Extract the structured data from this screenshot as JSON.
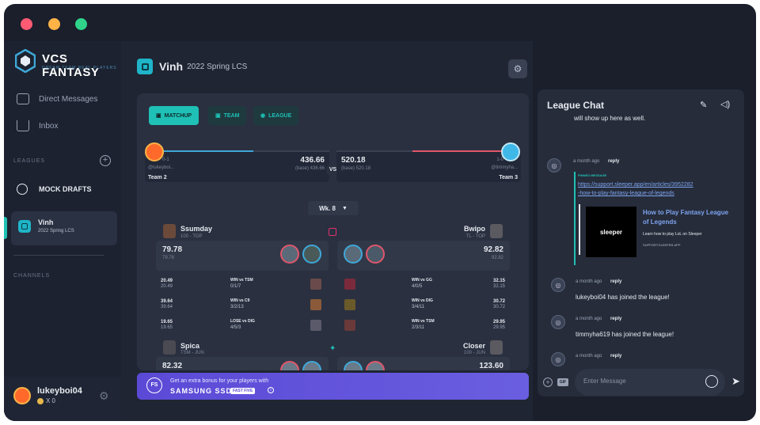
{
  "window": {
    "dots": [
      "#ff5a73",
      "#ffb347",
      "#2fd38a"
    ]
  },
  "brand": {
    "title": "VCS FANTASY",
    "subtitle": "DREAM TEAM REAL PLAYERS"
  },
  "sidebar": {
    "nav": [
      {
        "label": "Direct Messages",
        "icon": "message-icon"
      },
      {
        "label": "Inbox",
        "icon": "inbox-icon"
      }
    ],
    "leagues_header": "LEAGUES",
    "mock_drafts": "MOCK DRAFTS",
    "league": {
      "name": "Vinh",
      "season": "2022 Spring LCS"
    },
    "channels_header": "CHANNELS",
    "user": {
      "name": "lukeyboi04",
      "coins": "X 0"
    }
  },
  "main": {
    "league_name": "Vinh",
    "season": "2022 Spring LCS",
    "tabs": [
      {
        "label": "MATCHUP"
      },
      {
        "label": "TEAM"
      },
      {
        "label": "LEAGUE"
      }
    ],
    "matchup": {
      "left": {
        "record": "0-1",
        "handle": "@lukeyboi...",
        "score": "436.66",
        "base": "(base) 436.66",
        "team": "Team 2"
      },
      "right": {
        "record": "1-0",
        "handle": "@timmyha...",
        "score": "520.18",
        "base": "(base) 520.18",
        "team": "Team 3"
      },
      "vs": "VS",
      "week": "Wk. 8"
    },
    "players": [
      {
        "left": {
          "name": "Ssumday",
          "meta": "100 - TOP",
          "score": "79.78",
          "sub": "79.78"
        },
        "right": {
          "name": "Bwipo",
          "meta": "TL - TOP",
          "score": "92.82",
          "sub": "92.82"
        },
        "games": [
          {
            "l_pts": "20.49",
            "l_sub": "20.49",
            "l_res": "WIN vs TSM",
            "l_kda": "0/1/7",
            "r_res": "WIN vs GG",
            "r_kda": "4/0/5",
            "r_pts": "32.15",
            "r_sub": "32.15"
          },
          {
            "l_pts": "39.64",
            "l_sub": "39.64",
            "l_res": "WIN vs C9",
            "l_kda": "3/2/13",
            "r_res": "WIN vs DIG",
            "r_kda": "3/4/11",
            "r_pts": "30.72",
            "r_sub": "30.72"
          },
          {
            "l_pts": "19.65",
            "l_sub": "19.65",
            "l_res": "LOSE vs DIG",
            "l_kda": "4/5/3",
            "r_res": "WIN vs TSM",
            "r_kda": "2/3/11",
            "r_pts": "29.95",
            "r_sub": "29.95"
          }
        ]
      },
      {
        "left": {
          "name": "Spica",
          "meta": "TSM - JUN",
          "score": "82.32"
        },
        "right": {
          "name": "Closer",
          "meta": "100 - JUN",
          "score": "123.60"
        }
      }
    ],
    "banner": {
      "line1": "Get an extra bonus for your players with",
      "line2": "SAMSUNG SSD",
      "tag": "FAST FIVE",
      "logo": "FS"
    }
  },
  "chat": {
    "title": "League Chat",
    "intro": "will show up here as well.",
    "pinned": {
      "time": "a month ago",
      "reply": "reply",
      "label": "PINNED MESSAGE",
      "link1": "https://support.sleeper.app/en/articles/3952282",
      "link2": "-how-to-play-fantasy-league-of-legends",
      "card_title": "How to Play Fantasy League of Legends",
      "card_desc": "Learn how to play LoL on Sleeper",
      "card_site": "SUPPORT.SLEEPER.APP",
      "brand": "sleeper"
    },
    "messages": [
      {
        "time": "a month ago",
        "reply": "reply",
        "text": "lukeyboi04 has joined the league!"
      },
      {
        "time": "a month ago",
        "reply": "reply",
        "text": "timmyha619 has joined the league!"
      },
      {
        "time": "a month ago",
        "reply": "reply",
        "text": ""
      }
    ],
    "input_placeholder": "Enter Message",
    "gif": "GIF"
  }
}
